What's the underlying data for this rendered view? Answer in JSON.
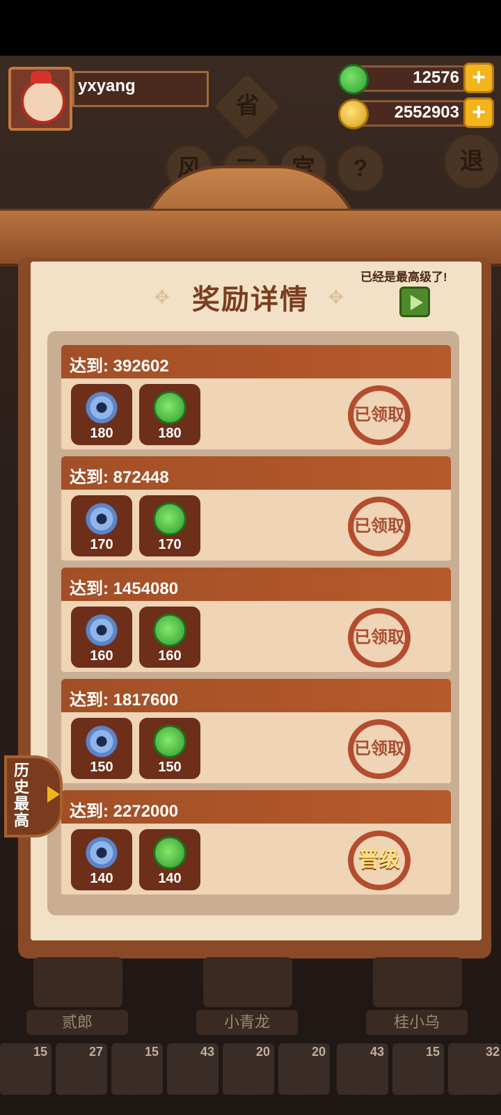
{
  "player": {
    "name": "yxyang"
  },
  "currency": {
    "jade": "12576",
    "coins": "2552903"
  },
  "background": {
    "province_badge": "省",
    "round_icons": [
      "风",
      "二",
      "宫",
      "?",
      "退"
    ]
  },
  "panel": {
    "title": "奖励详情",
    "max_level_note": "已经是最高级了!",
    "rows": [
      {
        "label": "达到: 392602",
        "blue": "180",
        "green": "180",
        "status": "已领取"
      },
      {
        "label": "达到: 872448",
        "blue": "170",
        "green": "170",
        "status": "已领取"
      },
      {
        "label": "达到: 1454080",
        "blue": "160",
        "green": "160",
        "status": "已领取"
      },
      {
        "label": "达到: 1817600",
        "blue": "150",
        "green": "150",
        "status": "已领取"
      },
      {
        "label": "达到: 2272000",
        "blue": "140",
        "green": "140",
        "status": "晋级"
      }
    ]
  },
  "side_tab": {
    "label": "历史最高"
  },
  "characters": [
    "贰郎",
    "小青龙",
    "桂小乌"
  ],
  "foods": [
    "15",
    "27",
    "15",
    "43",
    "20",
    "20",
    "43",
    "15",
    "32"
  ]
}
